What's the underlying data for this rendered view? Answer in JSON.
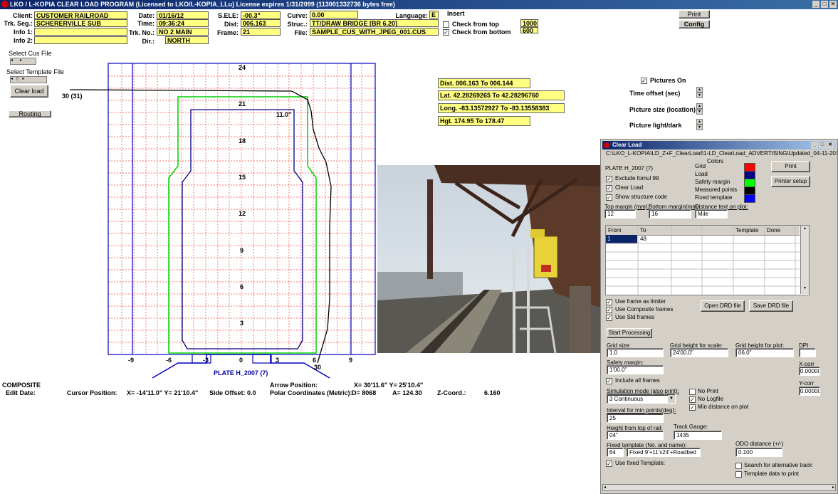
{
  "app_title": "LKO / L-KOPIA CLEAR LOAD PROGRAM   (Licensed to LKO/L-KOPIA_LLu)   License expires 1/31/2099   (113001332736 bytes free)",
  "header": {
    "client_label": "Client:",
    "client": "CUSTOMER RAILROAD",
    "trkseg_label": "Trk. Seg.:",
    "trkseg": "SCHERERVILLE SUB",
    "info1_label": "Info 1:",
    "info1": "",
    "info2_label": "Info 2:",
    "info2": "",
    "date_label": "Date:",
    "date": "01/16/12",
    "time_label": "Time:",
    "time": "09:36:24",
    "trkno_label": "Trk. No.:",
    "trkno": "NO 2 MAIN",
    "dir_label": "Dir.:",
    "dir": "NORTH",
    "sele_label": "S.ELE:",
    "sele": "-00.3\"",
    "dist_label": "Dist:",
    "dist": "006.163",
    "frame_label": "Frame:",
    "frame": "21",
    "curve_label": "Curve:",
    "curve": "0.00",
    "struc_label": "Struc.:",
    "struc": "TT/DRAW BRIDGE [BR 6.20]",
    "file_label": "File:",
    "file": "SAMPLE_CUS_WITH_JPEG_001.CUS",
    "language_label": "Language:",
    "language": "E",
    "insert_label": "Insert",
    "check_top_label": "Check from top",
    "check_top_value": "1000",
    "check_bottom_label": "Check from bottom",
    "check_bottom_value": "600",
    "print_label": "Print",
    "config_label": "Config"
  },
  "left": {
    "select_cus_label": "Select Cus File",
    "select_template_label": "Select Template File",
    "clear_load_label": "Clear load",
    "routing_label": "Routing",
    "pointer_label": "30 (31)"
  },
  "plot": {
    "y_labels": [
      "24",
      "21",
      "18",
      "15",
      "12",
      "9",
      "6",
      "3"
    ],
    "x_labels": [
      "-9",
      "-6",
      "-3",
      "0",
      "3",
      "6",
      "9"
    ],
    "offset_label": "11.0\"",
    "arrow_label": "30",
    "plate_label": "PLATE H_2007  (7)"
  },
  "info": {
    "dist": "Dist. 006.163 To 006.144",
    "lat": "Lat. 42.28269265 To 42.28296760",
    "long": "Long. -83.13572927 To -83.13558383",
    "hgt": "Hgt. 174.95 To 178.47"
  },
  "pictures": {
    "pictures_on": "Pictures On",
    "time_offset": "Time offset (sec)",
    "picture_size": "Picture size (location)",
    "picture_light": "Picture light/dark"
  },
  "status": {
    "composite": "COMPOSITE",
    "edit_date": "Edit Date:",
    "cursor_position": "Cursor Position:",
    "cursor_xy": "X=  -14'11.0\"  Y=  21'10.4\"",
    "side_offset": "Side Offset:   0.0",
    "arrow_position": "Arrow Position:",
    "arrow_xy": "X=  30'11.6\"   Y=  25'10.4\"",
    "polar": "Polar Coordinates (Metric):",
    "d": "D=  8068",
    "a": "A=  124.30",
    "zcoord": "Z-Coord.:",
    "zval": "6.160"
  },
  "dialog": {
    "title": "Clear Load",
    "path": "C:\\LKO_L-KOPIA\\LD_Z+F_ClearLoad\\1-LD_ClearLoad_ADVERTISING\\Updated_04-11-2014\\SAMPLE",
    "colors_label": "Colors",
    "plate": "PLATE H_2007  (7)",
    "exclude": "Exclude fomul 99",
    "clear_load": "Clear Load",
    "show_structure": "Show structure code",
    "legend": [
      "Grid",
      "Load",
      "Safety margin",
      "Measured points",
      "Fixed template"
    ],
    "legend_colors": [
      "#ff0000",
      "#000080",
      "#00ff00",
      "#000000",
      "#0000ff"
    ],
    "print": "Print",
    "printer_setup": "Printer setup",
    "top_margin_label": "Top margin (mm):",
    "top_margin": "12",
    "bottom_margin_label": "Bottom margin(mm):",
    "bottom_margin": "16",
    "distance_text_label": "Distance text on plot:",
    "distance_text": "Mile",
    "table_headers": [
      "From",
      "To",
      "",
      "",
      "Template",
      "Done"
    ],
    "table_rows": [
      [
        "1",
        "48",
        "",
        "",
        "",
        ""
      ]
    ],
    "use_frame": "Use frame as limiter",
    "use_composite": "Use Composite frames",
    "use_std": "Use Std frames",
    "open_drd": "Open DRD file",
    "save_drd": "Save DRD file",
    "start_processing": "Start Processing",
    "grid_size_label": "Grid size:",
    "grid_size": "1.0",
    "grid_height_scale_label": "Grid height for scale:",
    "grid_height_scale": "24'00.0\"",
    "grid_height_plot_label": "Grid height for plot:",
    "grid_height_plot": "06.0\"",
    "dpi_label": "DPI",
    "dpi": "",
    "safety_margin_label": "Safety margin:",
    "safety_margin": "1'00.0\"",
    "xcorr_label": "X-corr",
    "xcorr": "0.00000",
    "include_all": "Include all frames",
    "ycorr_label": "Y-corr",
    "ycorr": "0.00000",
    "sim_mode_label": "Simulation mode (also print):",
    "sim_mode": "3  Continuous",
    "no_print": "No Print",
    "no_logfile": "No Logfile",
    "min_distance": "Min distance on plot",
    "interval_label": "Interval for min points(deg):",
    "interval": "25",
    "height_label": "Height from top of rail:",
    "height": "04\"",
    "gauge_label": "Track Gauge:",
    "gauge": "1435",
    "fixed_template_label": "Fixed template (No. and name):",
    "fixed_no": "64",
    "fixed_name": "Fixed 9'+11'x24'+Roadbed",
    "odo_label": "ODO distance (+/-)",
    "odo": "0.100",
    "use_fixed": "Use fixed Template:",
    "search_alt": "Search for alternative track",
    "template_data": "Template data to print"
  }
}
